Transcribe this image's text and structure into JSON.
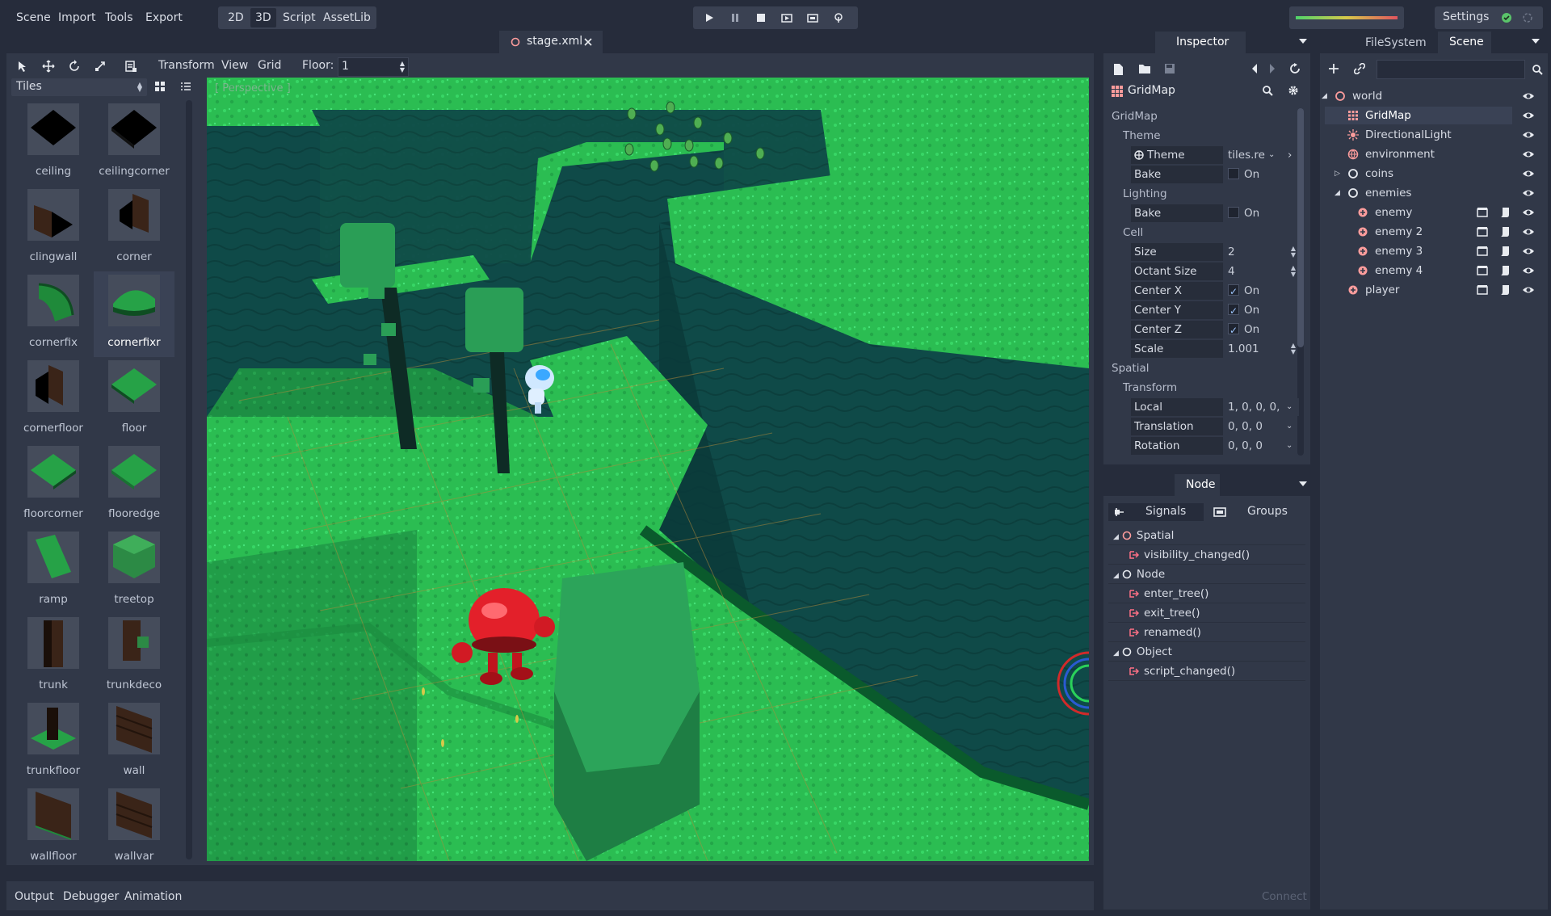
{
  "menubar": {
    "items": [
      "Scene",
      "Import",
      "Tools",
      "Export"
    ]
  },
  "workspace": {
    "items": [
      "2D",
      "3D",
      "Script",
      "AssetLib"
    ],
    "active": "3D"
  },
  "settings_label": "Settings",
  "tab": {
    "title": "stage.xml"
  },
  "toolbar3d": {
    "menus": [
      "Transform",
      "View",
      "Grid"
    ],
    "floor_label": "Floor:",
    "floor_value": "1"
  },
  "tiles_panel": {
    "dropdown": "Tiles",
    "items": [
      {
        "name": "ceiling",
        "icon": "ceiling-tile-icon"
      },
      {
        "name": "ceilingcorner",
        "icon": "ceilingcorner-tile-icon"
      },
      {
        "name": "clingwall",
        "icon": "clingwall-tile-icon"
      },
      {
        "name": "corner",
        "icon": "corner-tile-icon"
      },
      {
        "name": "cornerfix",
        "icon": "cornerfix-tile-icon"
      },
      {
        "name": "cornerfixr",
        "icon": "cornerfixr-tile-icon"
      },
      {
        "name": "cornerfloor",
        "icon": "cornerfloor-tile-icon"
      },
      {
        "name": "floor",
        "icon": "floor-tile-icon"
      },
      {
        "name": "floorcorner",
        "icon": "floorcorner-tile-icon"
      },
      {
        "name": "flooredge",
        "icon": "flooredge-tile-icon"
      },
      {
        "name": "ramp",
        "icon": "ramp-tile-icon"
      },
      {
        "name": "treetop",
        "icon": "treetop-tile-icon"
      },
      {
        "name": "trunk",
        "icon": "trunk-tile-icon"
      },
      {
        "name": "trunkdeco",
        "icon": "trunkdeco-tile-icon"
      },
      {
        "name": "trunkfloor",
        "icon": "trunkfloor-tile-icon"
      },
      {
        "name": "wall",
        "icon": "wall-tile-icon"
      },
      {
        "name": "wallfloor",
        "icon": "wallfloor-tile-icon"
      },
      {
        "name": "wallvar",
        "icon": "wallvar-tile-icon"
      }
    ],
    "selected": "cornerfixr"
  },
  "viewport": {
    "label": "[ Perspective ]"
  },
  "inspector": {
    "tab": "Inspector",
    "object_name": "GridMap",
    "class_section": "GridMap",
    "theme_section": "Theme",
    "theme": {
      "label": "Theme",
      "value": "tiles.re"
    },
    "bake1": {
      "label": "Bake",
      "value": "On"
    },
    "lighting_section": "Lighting",
    "bake2": {
      "label": "Bake",
      "value": "On"
    },
    "cell_section": "Cell",
    "size": {
      "label": "Size",
      "value": "2"
    },
    "octant": {
      "label": "Octant Size",
      "value": "4"
    },
    "centerx": {
      "label": "Center X",
      "value": "On"
    },
    "centery": {
      "label": "Center Y",
      "value": "On"
    },
    "centerz": {
      "label": "Center Z",
      "value": "On"
    },
    "scale": {
      "label": "Scale",
      "value": "1.001"
    },
    "spatial_section": "Spatial",
    "transform_section": "Transform",
    "local": {
      "label": "Local",
      "value": "1, 0, 0, 0,"
    },
    "translation": {
      "label": "Translation",
      "value": "0, 0, 0"
    },
    "rotation": {
      "label": "Rotation",
      "value": "0, 0, 0"
    }
  },
  "node_panel": {
    "tab": "Node",
    "signals_tab": "Signals",
    "groups_tab": "Groups",
    "connect_label": "Connect",
    "rows": [
      {
        "text": "Spatial",
        "kind": "class"
      },
      {
        "text": "visibility_changed()",
        "kind": "signal"
      },
      {
        "text": "Node",
        "kind": "class"
      },
      {
        "text": "enter_tree()",
        "kind": "signal"
      },
      {
        "text": "exit_tree()",
        "kind": "signal"
      },
      {
        "text": "renamed()",
        "kind": "signal"
      },
      {
        "text": "Object",
        "kind": "class"
      },
      {
        "text": "script_changed()",
        "kind": "signal"
      }
    ]
  },
  "scene_dock": {
    "tabs": [
      "FileSystem",
      "Scene"
    ],
    "active": "Scene",
    "tree": [
      {
        "name": "world",
        "depth": 0
      },
      {
        "name": "GridMap",
        "depth": 1
      },
      {
        "name": "DirectionalLight",
        "depth": 1
      },
      {
        "name": "environment",
        "depth": 1
      },
      {
        "name": "coins",
        "depth": 1
      },
      {
        "name": "enemies",
        "depth": 1
      },
      {
        "name": "enemy",
        "depth": 2
      },
      {
        "name": "enemy 2",
        "depth": 2
      },
      {
        "name": "enemy 3",
        "depth": 2
      },
      {
        "name": "enemy 4",
        "depth": 2
      },
      {
        "name": "player",
        "depth": 1
      }
    ]
  },
  "bottom_tabs": [
    "Output",
    "Debugger",
    "Animation"
  ],
  "colors": {
    "accent": "#4f9bff",
    "panel": "#313848",
    "background": "#262c3b",
    "grass": "#2ec254"
  }
}
